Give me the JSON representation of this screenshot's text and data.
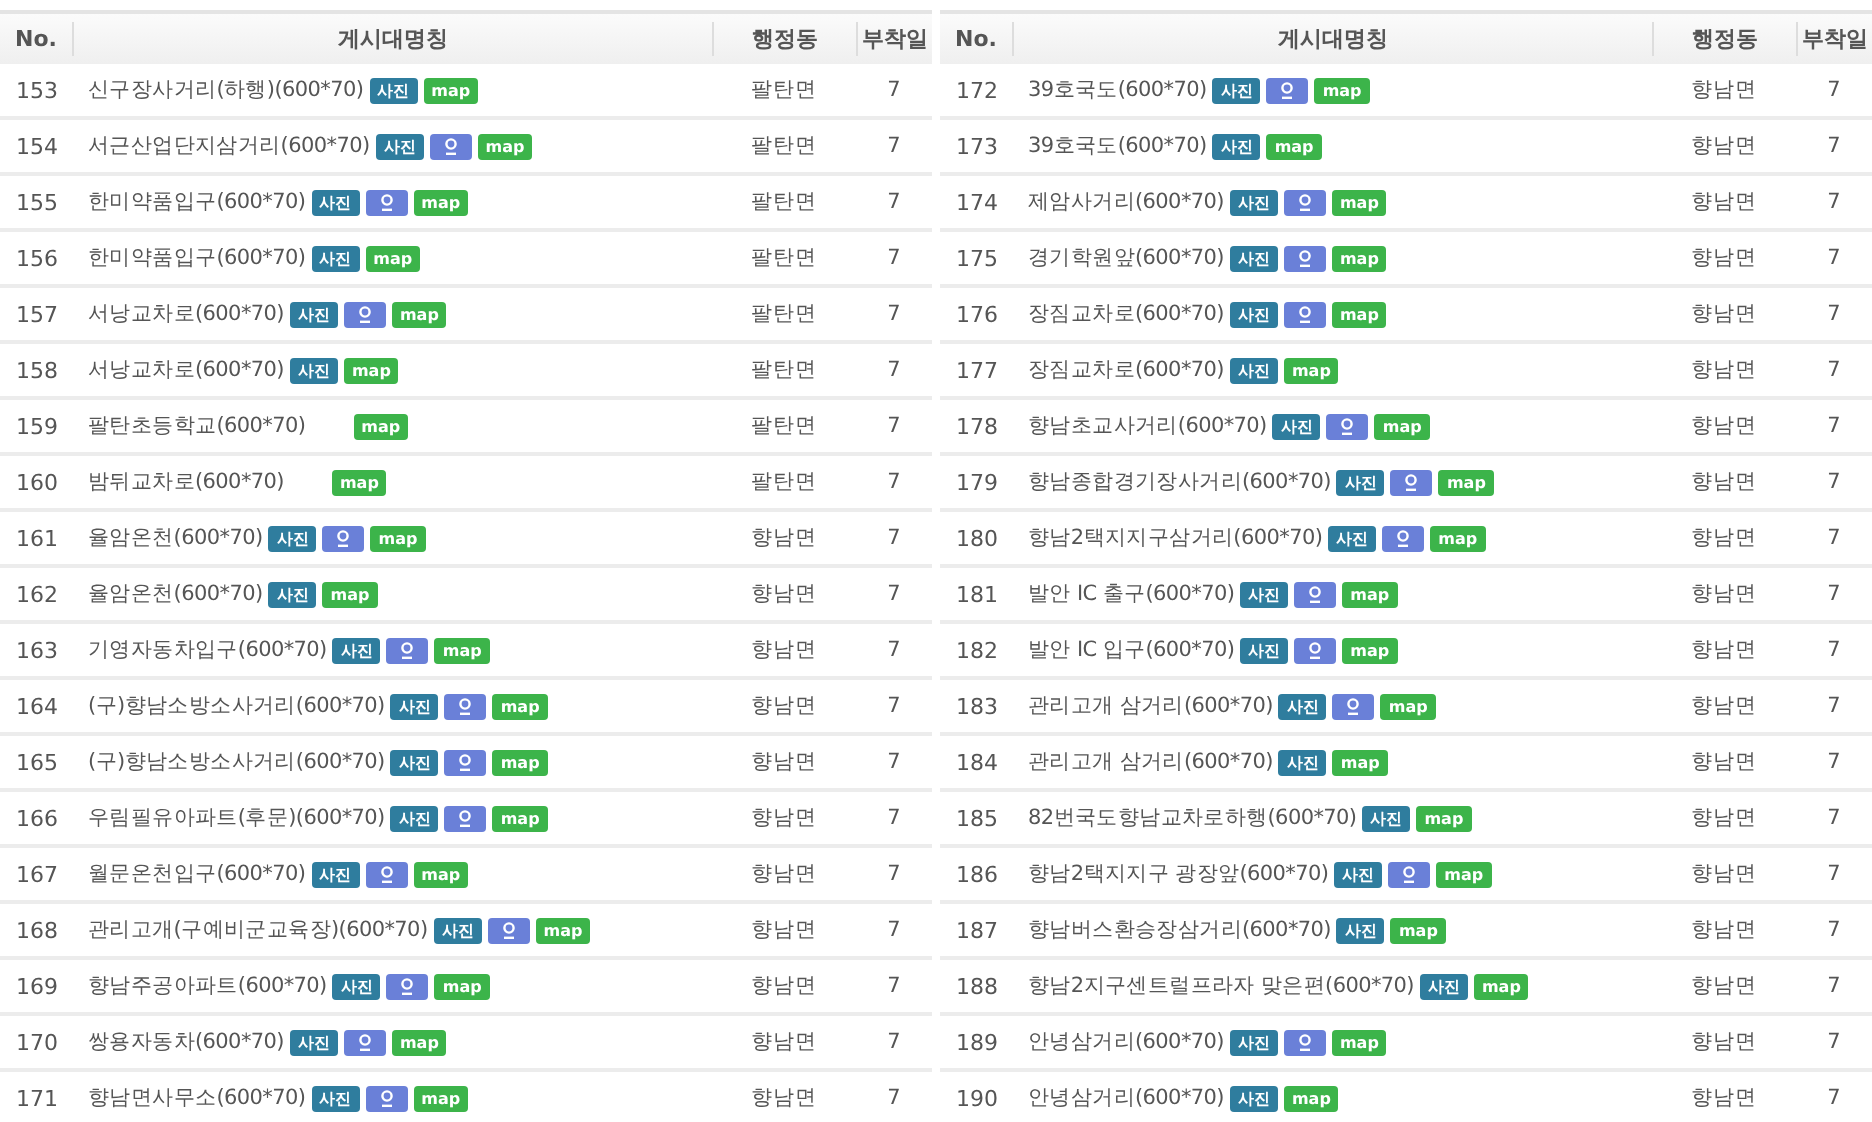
{
  "tables": [
    {
      "columns": [
        "No.",
        "게시대명칭",
        "행정동",
        "부착일"
      ],
      "rows": [
        {
          "no": "153",
          "name": "신구장사거리(하행)(600*70)",
          "dong": "팔탄면",
          "days": "7",
          "buttons": [
            {
              "kind": "photo",
              "label": "사진"
            },
            {
              "kind": "map",
              "label": "map"
            }
          ]
        },
        {
          "no": "154",
          "name": "서근산업단지삼거리(600*70)",
          "dong": "팔탄면",
          "days": "7",
          "buttons": [
            {
              "kind": "photo",
              "label": "사진"
            },
            {
              "kind": "pin"
            },
            {
              "kind": "map",
              "label": "map"
            }
          ]
        },
        {
          "no": "155",
          "name": "한미약품입구(600*70)",
          "dong": "팔탄면",
          "days": "7",
          "buttons": [
            {
              "kind": "photo",
              "label": "사진"
            },
            {
              "kind": "pin"
            },
            {
              "kind": "map",
              "label": "map"
            }
          ]
        },
        {
          "no": "156",
          "name": "한미약품입구(600*70)",
          "dong": "팔탄면",
          "days": "7",
          "buttons": [
            {
              "kind": "photo",
              "label": "사진"
            },
            {
              "kind": "map",
              "label": "map"
            }
          ]
        },
        {
          "no": "157",
          "name": "서낭교차로(600*70)",
          "dong": "팔탄면",
          "days": "7",
          "buttons": [
            {
              "kind": "photo",
              "label": "사진"
            },
            {
              "kind": "pin"
            },
            {
              "kind": "map",
              "label": "map"
            }
          ]
        },
        {
          "no": "158",
          "name": "서낭교차로(600*70)",
          "dong": "팔탄면",
          "days": "7",
          "buttons": [
            {
              "kind": "photo",
              "label": "사진"
            },
            {
              "kind": "map",
              "label": "map"
            }
          ]
        },
        {
          "no": "159",
          "name": "팔탄초등학교(600*70)",
          "dong": "팔탄면",
          "days": "7",
          "buttons": [
            {
              "kind": "gap"
            },
            {
              "kind": "map",
              "label": "map"
            }
          ]
        },
        {
          "no": "160",
          "name": "밤뒤교차로(600*70)",
          "dong": "팔탄면",
          "days": "7",
          "buttons": [
            {
              "kind": "gap"
            },
            {
              "kind": "map",
              "label": "map"
            }
          ]
        },
        {
          "no": "161",
          "name": "율암온천(600*70)",
          "dong": "향남면",
          "days": "7",
          "buttons": [
            {
              "kind": "photo",
              "label": "사진"
            },
            {
              "kind": "pin"
            },
            {
              "kind": "map",
              "label": "map"
            }
          ]
        },
        {
          "no": "162",
          "name": "율암온천(600*70)",
          "dong": "향남면",
          "days": "7",
          "buttons": [
            {
              "kind": "photo",
              "label": "사진"
            },
            {
              "kind": "map",
              "label": "map"
            }
          ]
        },
        {
          "no": "163",
          "name": "기영자동차입구(600*70)",
          "dong": "향남면",
          "days": "7",
          "buttons": [
            {
              "kind": "photo",
              "label": "사진"
            },
            {
              "kind": "pin"
            },
            {
              "kind": "map",
              "label": "map"
            }
          ]
        },
        {
          "no": "164",
          "name": "(구)향남소방소사거리(600*70)",
          "dong": "향남면",
          "days": "7",
          "buttons": [
            {
              "kind": "photo",
              "label": "사진"
            },
            {
              "kind": "pin"
            },
            {
              "kind": "map",
              "label": "map"
            }
          ]
        },
        {
          "no": "165",
          "name": "(구)향남소방소사거리(600*70)",
          "dong": "향남면",
          "days": "7",
          "buttons": [
            {
              "kind": "photo",
              "label": "사진"
            },
            {
              "kind": "pin"
            },
            {
              "kind": "map",
              "label": "map"
            }
          ]
        },
        {
          "no": "166",
          "name": "우림필유아파트(후문)(600*70)",
          "dong": "향남면",
          "days": "7",
          "buttons": [
            {
              "kind": "photo",
              "label": "사진"
            },
            {
              "kind": "pin"
            },
            {
              "kind": "map",
              "label": "map"
            }
          ]
        },
        {
          "no": "167",
          "name": "월문온천입구(600*70)",
          "dong": "향남면",
          "days": "7",
          "buttons": [
            {
              "kind": "photo",
              "label": "사진"
            },
            {
              "kind": "pin"
            },
            {
              "kind": "map",
              "label": "map"
            }
          ]
        },
        {
          "no": "168",
          "name": "관리고개(구예비군교육장)(600*70)",
          "dong": "향남면",
          "days": "7",
          "buttons": [
            {
              "kind": "photo",
              "label": "사진"
            },
            {
              "kind": "pin"
            },
            {
              "kind": "map",
              "label": "map"
            }
          ]
        },
        {
          "no": "169",
          "name": "향남주공아파트(600*70)",
          "dong": "향남면",
          "days": "7",
          "buttons": [
            {
              "kind": "photo",
              "label": "사진"
            },
            {
              "kind": "pin"
            },
            {
              "kind": "map",
              "label": "map"
            }
          ]
        },
        {
          "no": "170",
          "name": "쌍용자동차(600*70)",
          "dong": "향남면",
          "days": "7",
          "buttons": [
            {
              "kind": "photo",
              "label": "사진"
            },
            {
              "kind": "pin"
            },
            {
              "kind": "map",
              "label": "map"
            }
          ]
        },
        {
          "no": "171",
          "name": "향남면사무소(600*70)",
          "dong": "향남면",
          "days": "7",
          "buttons": [
            {
              "kind": "photo",
              "label": "사진"
            },
            {
              "kind": "pin"
            },
            {
              "kind": "map",
              "label": "map"
            }
          ]
        }
      ]
    },
    {
      "columns": [
        "No.",
        "게시대명칭",
        "행정동",
        "부착일"
      ],
      "rows": [
        {
          "no": "172",
          "name": "39호국도(600*70)",
          "dong": "향남면",
          "days": "7",
          "buttons": [
            {
              "kind": "photo",
              "label": "사진"
            },
            {
              "kind": "pin"
            },
            {
              "kind": "map",
              "label": "map"
            }
          ]
        },
        {
          "no": "173",
          "name": "39호국도(600*70)",
          "dong": "향남면",
          "days": "7",
          "buttons": [
            {
              "kind": "photo",
              "label": "사진"
            },
            {
              "kind": "map",
              "label": "map"
            }
          ]
        },
        {
          "no": "174",
          "name": "제암사거리(600*70)",
          "dong": "향남면",
          "days": "7",
          "buttons": [
            {
              "kind": "photo",
              "label": "사진"
            },
            {
              "kind": "pin"
            },
            {
              "kind": "map",
              "label": "map"
            }
          ]
        },
        {
          "no": "175",
          "name": "경기학원앞(600*70)",
          "dong": "향남면",
          "days": "7",
          "buttons": [
            {
              "kind": "photo",
              "label": "사진"
            },
            {
              "kind": "pin"
            },
            {
              "kind": "map",
              "label": "map"
            }
          ]
        },
        {
          "no": "176",
          "name": "장짐교차로(600*70)",
          "dong": "향남면",
          "days": "7",
          "buttons": [
            {
              "kind": "photo",
              "label": "사진"
            },
            {
              "kind": "pin"
            },
            {
              "kind": "map",
              "label": "map"
            }
          ]
        },
        {
          "no": "177",
          "name": "장짐교차로(600*70)",
          "dong": "향남면",
          "days": "7",
          "buttons": [
            {
              "kind": "photo",
              "label": "사진"
            },
            {
              "kind": "map",
              "label": "map"
            }
          ]
        },
        {
          "no": "178",
          "name": "향남초교사거리(600*70)",
          "dong": "향남면",
          "days": "7",
          "buttons": [
            {
              "kind": "photo",
              "label": "사진"
            },
            {
              "kind": "pin"
            },
            {
              "kind": "map",
              "label": "map"
            }
          ]
        },
        {
          "no": "179",
          "name": "향남종합경기장사거리(600*70)",
          "dong": "향남면",
          "days": "7",
          "buttons": [
            {
              "kind": "photo",
              "label": "사진"
            },
            {
              "kind": "pin"
            },
            {
              "kind": "map",
              "label": "map"
            }
          ]
        },
        {
          "no": "180",
          "name": "향남2택지지구삼거리(600*70)",
          "dong": "향남면",
          "days": "7",
          "buttons": [
            {
              "kind": "photo",
              "label": "사진"
            },
            {
              "kind": "pin"
            },
            {
              "kind": "map",
              "label": "map"
            }
          ]
        },
        {
          "no": "181",
          "name": "발안 IC 출구(600*70)",
          "dong": "향남면",
          "days": "7",
          "buttons": [
            {
              "kind": "photo",
              "label": "사진"
            },
            {
              "kind": "pin"
            },
            {
              "kind": "map",
              "label": "map"
            }
          ]
        },
        {
          "no": "182",
          "name": "발안 IC 입구(600*70)",
          "dong": "향남면",
          "days": "7",
          "buttons": [
            {
              "kind": "photo",
              "label": "사진"
            },
            {
              "kind": "pin"
            },
            {
              "kind": "map",
              "label": "map"
            }
          ]
        },
        {
          "no": "183",
          "name": "관리고개 삼거리(600*70)",
          "dong": "향남면",
          "days": "7",
          "buttons": [
            {
              "kind": "photo",
              "label": "사진"
            },
            {
              "kind": "pin"
            },
            {
              "kind": "map",
              "label": "map"
            }
          ]
        },
        {
          "no": "184",
          "name": "관리고개 삼거리(600*70)",
          "dong": "향남면",
          "days": "7",
          "buttons": [
            {
              "kind": "photo",
              "label": "사진"
            },
            {
              "kind": "map",
              "label": "map"
            }
          ]
        },
        {
          "no": "185",
          "name": "82번국도향남교차로하행(600*70)",
          "dong": "향남면",
          "days": "7",
          "buttons": [
            {
              "kind": "photo",
              "label": "사진"
            },
            {
              "kind": "map",
              "label": "map"
            }
          ]
        },
        {
          "no": "186",
          "name": "향남2택지지구 광장앞(600*70)",
          "dong": "향남면",
          "days": "7",
          "buttons": [
            {
              "kind": "photo",
              "label": "사진"
            },
            {
              "kind": "pin"
            },
            {
              "kind": "map",
              "label": "map"
            }
          ]
        },
        {
          "no": "187",
          "name": "향남버스환승장삼거리(600*70)",
          "dong": "향남면",
          "days": "7",
          "buttons": [
            {
              "kind": "photo",
              "label": "사진"
            },
            {
              "kind": "map",
              "label": "map"
            }
          ]
        },
        {
          "no": "188",
          "name": "향남2지구센트럴프라자 맞은편(600*70)",
          "dong": "향남면",
          "days": "7",
          "buttons": [
            {
              "kind": "photo",
              "label": "사진"
            },
            {
              "kind": "map",
              "label": "map"
            }
          ]
        },
        {
          "no": "189",
          "name": "안녕삼거리(600*70)",
          "dong": "향남면",
          "days": "7",
          "buttons": [
            {
              "kind": "photo",
              "label": "사진"
            },
            {
              "kind": "pin"
            },
            {
              "kind": "map",
              "label": "map"
            }
          ]
        },
        {
          "no": "190",
          "name": "안녕삼거리(600*70)",
          "dong": "향남면",
          "days": "7",
          "buttons": [
            {
              "kind": "photo",
              "label": "사진"
            },
            {
              "kind": "map",
              "label": "map"
            }
          ]
        }
      ]
    }
  ]
}
